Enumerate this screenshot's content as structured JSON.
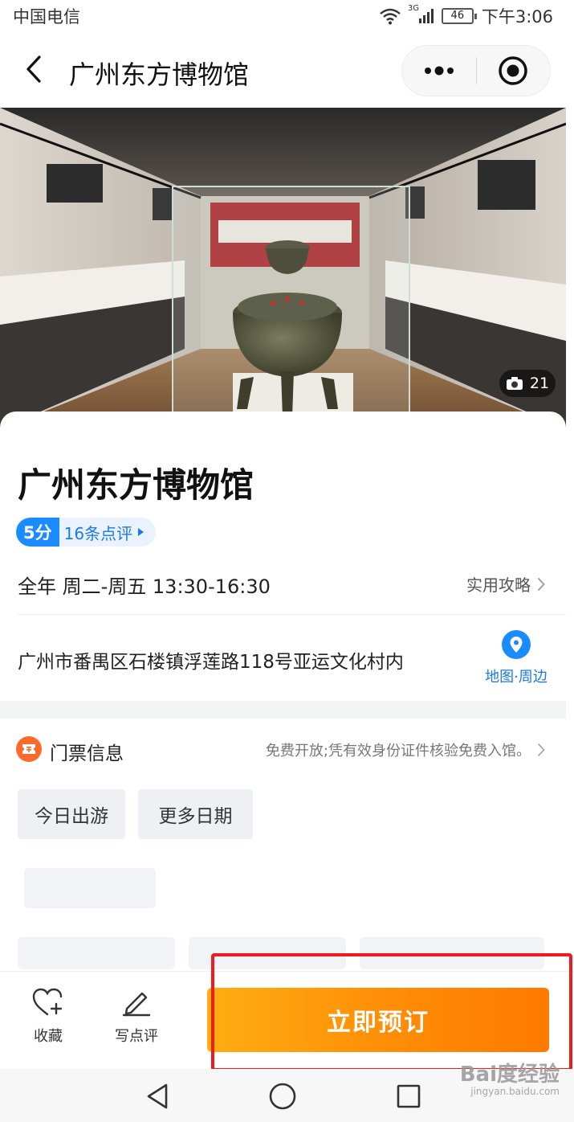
{
  "status_bar": {
    "carrier": "中国电信",
    "network": "3G",
    "battery": "46",
    "time": "下午3:06"
  },
  "header": {
    "title": "广州东方博物馆",
    "back_icon": "chevron-left-icon",
    "more_icon": "more-dots-icon",
    "close_icon": "target-close-icon"
  },
  "hero": {
    "photo_count": "21",
    "camera_icon": "camera-icon"
  },
  "poi": {
    "name": "广州东方博物馆",
    "score": "5分",
    "reviews_label": "16条点评",
    "hours": "全年 周二-周五 13:30-16:30",
    "guide_label": "实用攻略",
    "address": "广州市番禺区石楼镇浮莲路118号亚运文化村内",
    "map_label": "地图·周边"
  },
  "tickets": {
    "title": "门票信息",
    "description": "免费开放;凭有效身份证件核验免费入馆。",
    "date_options": [
      "今日出游",
      "更多日期"
    ]
  },
  "action_bar": {
    "favorite_label": "收藏",
    "review_label": "写点评",
    "book_label": "立即预订"
  },
  "colors": {
    "brand_blue": "#1a8cff",
    "book_orange": "#ff8a05",
    "highlight_red": "#ee1c1c",
    "ticket_orange": "#ff6a2a"
  },
  "watermark": {
    "main": "Bai度经验",
    "sub": "jingyan.baidu.com"
  }
}
